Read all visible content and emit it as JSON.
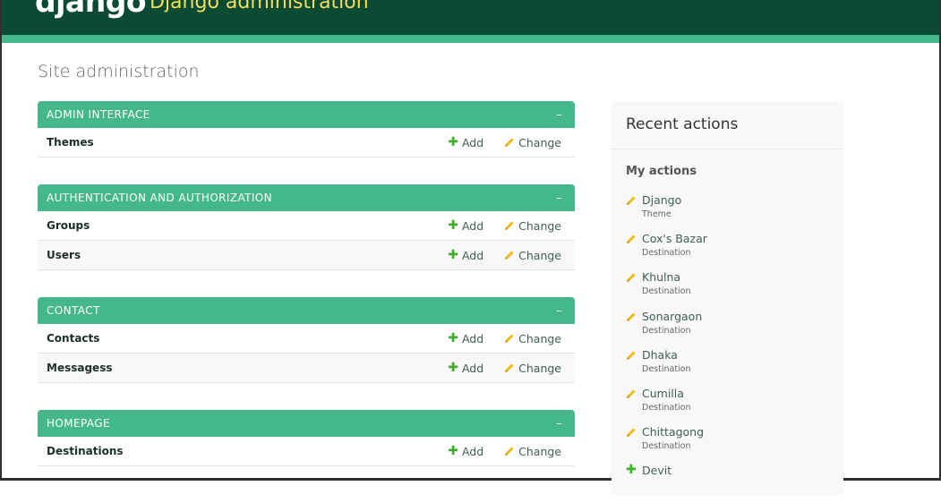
{
  "header": {
    "logo": "django",
    "site_title": "Django administration"
  },
  "page_title": "Site administration",
  "modules": [
    {
      "caption": "ADMIN INTERFACE",
      "collapse": "–",
      "models": [
        {
          "name": "Themes"
        }
      ]
    },
    {
      "caption": "AUTHENTICATION AND AUTHORIZATION",
      "collapse": "–",
      "models": [
        {
          "name": "Groups"
        },
        {
          "name": "Users"
        }
      ]
    },
    {
      "caption": "CONTACT",
      "collapse": "–",
      "models": [
        {
          "name": "Contacts"
        },
        {
          "name": "Messagess"
        }
      ]
    },
    {
      "caption": "HOMEPAGE",
      "collapse": "–",
      "models": [
        {
          "name": "Destinations"
        }
      ]
    }
  ],
  "labels": {
    "add": "Add",
    "change": "Change"
  },
  "recent": {
    "title": "Recent actions",
    "subtitle": "My actions",
    "items": [
      {
        "name": "Django",
        "type": "Theme",
        "icon": "pencil-icon"
      },
      {
        "name": "Cox's Bazar",
        "type": "Destination",
        "icon": "pencil-icon"
      },
      {
        "name": "Khulna",
        "type": "Destination",
        "icon": "pencil-icon"
      },
      {
        "name": "Sonargaon",
        "type": "Destination",
        "icon": "pencil-icon"
      },
      {
        "name": "Dhaka",
        "type": "Destination",
        "icon": "pencil-icon"
      },
      {
        "name": "Cumilla",
        "type": "Destination",
        "icon": "pencil-icon"
      },
      {
        "name": "Chittagong",
        "type": "Destination",
        "icon": "pencil-icon"
      },
      {
        "name": "Devit",
        "type": "",
        "icon": "plus-icon"
      }
    ]
  },
  "colors": {
    "header_bg": "#0c4b33",
    "accent": "#44b78b",
    "brand_title": "#f5dd5d",
    "add_icon": "#3fae2a",
    "change_icon": "#efb80b"
  }
}
